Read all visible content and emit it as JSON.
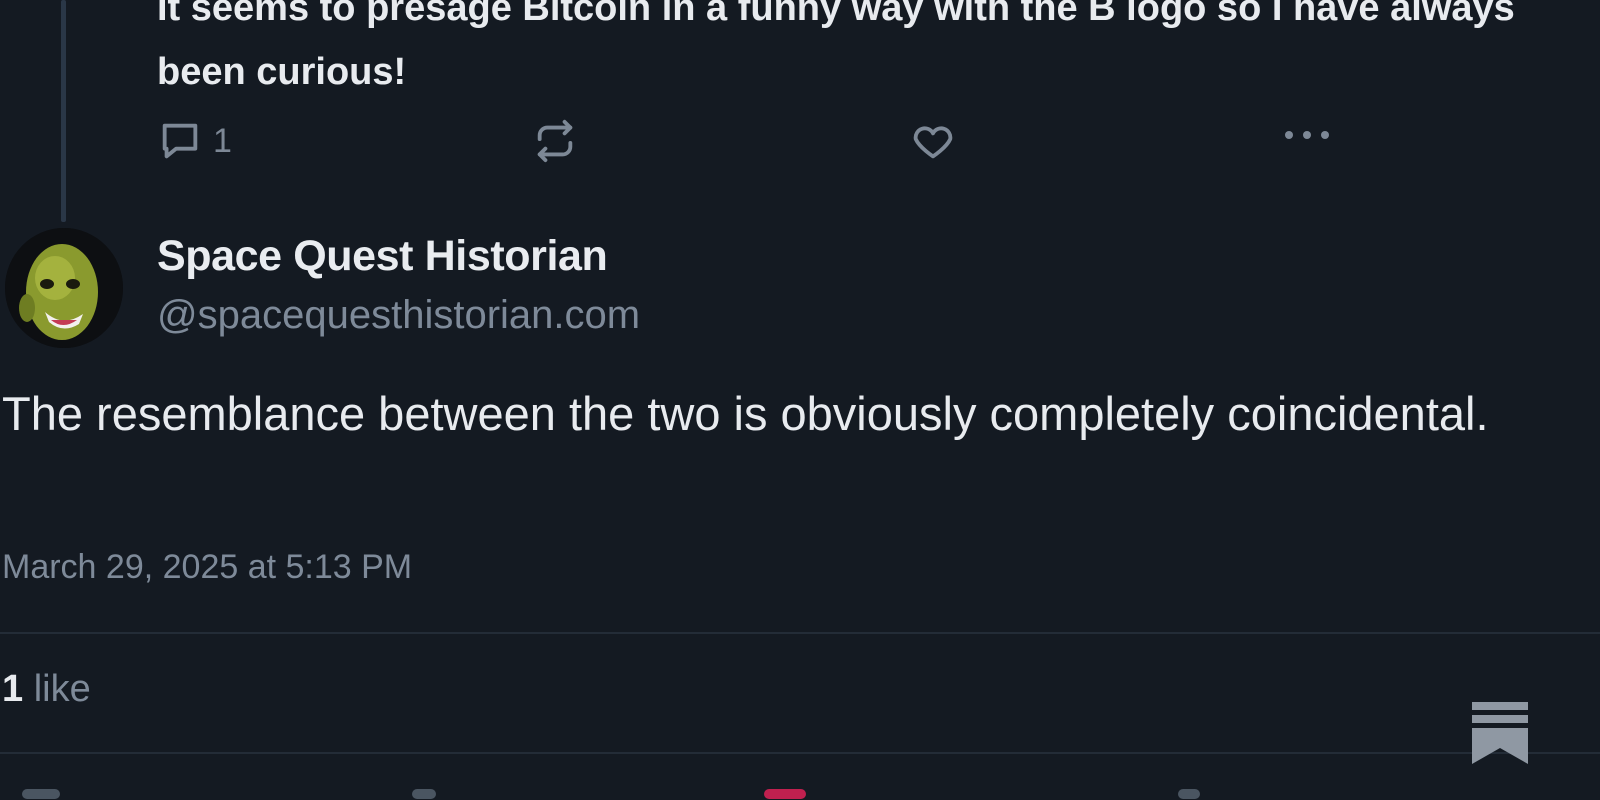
{
  "parent_post": {
    "text": "It seems to presage Bitcoin in a funny way with the B logo so I have always been curious!",
    "reply_count": "1"
  },
  "post": {
    "author_name": "Space Quest Historian",
    "author_handle": "@spacequesthistorian.com",
    "body": "The resemblance between the two is obviously completely coincidental.",
    "timestamp": "March 29, 2025 at 5:13 PM",
    "likes_count": "1",
    "likes_label": "like"
  },
  "icons": {
    "reply": "reply-icon",
    "repost": "repost-icon",
    "like": "heart-icon",
    "more": "more-icon",
    "bookmark": "substack-bookmark-icon"
  },
  "colors": {
    "background": "#141a22",
    "text": "#e8ebef",
    "muted": "#7e8a99",
    "like_accent": "#e0245e"
  }
}
